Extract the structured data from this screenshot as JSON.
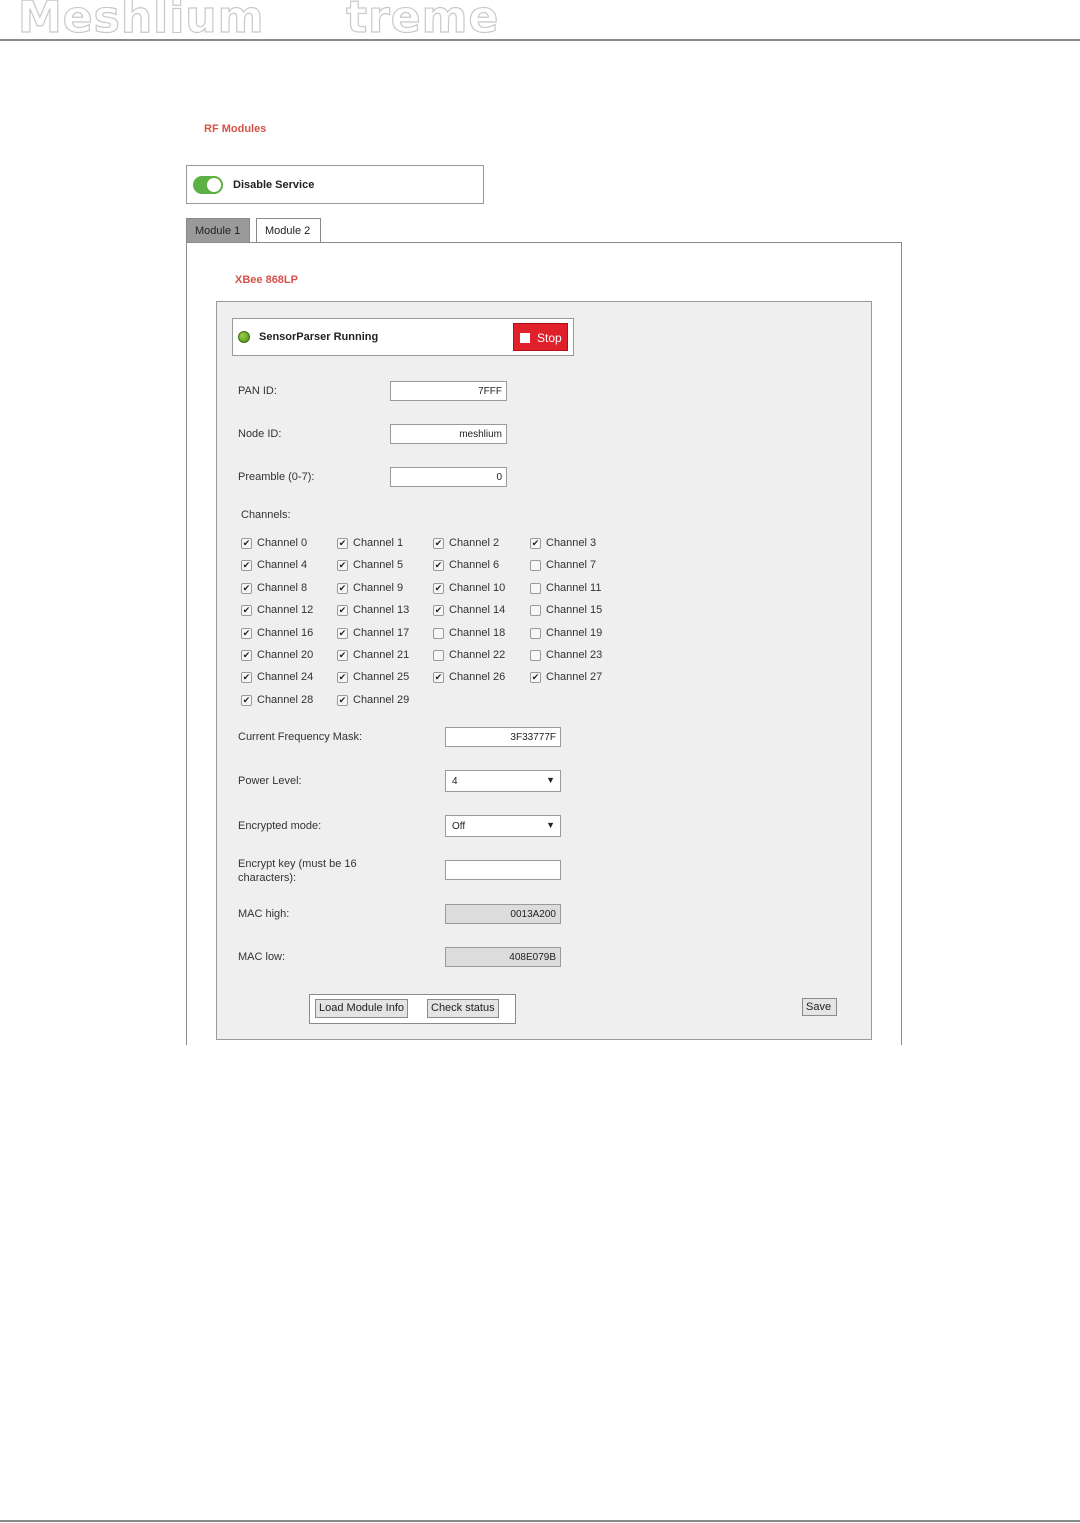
{
  "brand": {
    "name": "Meshlium     treme"
  },
  "section": {
    "title": "RF Modules"
  },
  "service": {
    "toggle_label": "Disable Service",
    "enabled": true
  },
  "tabs": [
    {
      "label": "Module 1",
      "active": true
    },
    {
      "label": "Module 2",
      "active": false
    }
  ],
  "module": {
    "title": "XBee 868LP",
    "status": {
      "label": "SensorParser Running",
      "stop_label": "Stop"
    },
    "fields": {
      "pan_id": {
        "label": "PAN ID:",
        "value": "7FFF"
      },
      "node_id": {
        "label": "Node ID:",
        "value": "meshlium"
      },
      "preamble": {
        "label": "Preamble (0-7):",
        "value": "0"
      }
    },
    "channels_label": "Channels:",
    "channels": [
      {
        "label": "Channel 0",
        "checked": true
      },
      {
        "label": "Channel 1",
        "checked": true
      },
      {
        "label": "Channel 2",
        "checked": true
      },
      {
        "label": "Channel 3",
        "checked": true
      },
      {
        "label": "Channel 4",
        "checked": true
      },
      {
        "label": "Channel 5",
        "checked": true
      },
      {
        "label": "Channel 6",
        "checked": true
      },
      {
        "label": "Channel 7",
        "checked": false
      },
      {
        "label": "Channel 8",
        "checked": true
      },
      {
        "label": "Channel 9",
        "checked": true
      },
      {
        "label": "Channel 10",
        "checked": true
      },
      {
        "label": "Channel 11",
        "checked": false
      },
      {
        "label": "Channel 12",
        "checked": true
      },
      {
        "label": "Channel 13",
        "checked": true
      },
      {
        "label": "Channel 14",
        "checked": true
      },
      {
        "label": "Channel 15",
        "checked": false
      },
      {
        "label": "Channel 16",
        "checked": true
      },
      {
        "label": "Channel 17",
        "checked": true
      },
      {
        "label": "Channel 18",
        "checked": false
      },
      {
        "label": "Channel 19",
        "checked": false
      },
      {
        "label": "Channel 20",
        "checked": true
      },
      {
        "label": "Channel 21",
        "checked": true
      },
      {
        "label": "Channel 22",
        "checked": false
      },
      {
        "label": "Channel 23",
        "checked": false
      },
      {
        "label": "Channel 24",
        "checked": true
      },
      {
        "label": "Channel 25",
        "checked": true
      },
      {
        "label": "Channel 26",
        "checked": true
      },
      {
        "label": "Channel 27",
        "checked": true
      },
      {
        "label": "Channel 28",
        "checked": true
      },
      {
        "label": "Channel 29",
        "checked": true
      }
    ],
    "freq_mask": {
      "label": "Current Frequency Mask:",
      "value": "3F33777F"
    },
    "power_level": {
      "label": "Power Level:",
      "value": "4"
    },
    "encrypted_mode": {
      "label": "Encrypted mode:",
      "value": "Off"
    },
    "encrypt_key": {
      "label": "Encrypt key (must be 16 characters):",
      "value": ""
    },
    "mac_high": {
      "label": "MAC high:",
      "value": "0013A200"
    },
    "mac_low": {
      "label": "MAC low:",
      "value": "408E079B"
    },
    "buttons": {
      "load": "Load Module Info",
      "check": "Check status",
      "save": "Save"
    }
  }
}
